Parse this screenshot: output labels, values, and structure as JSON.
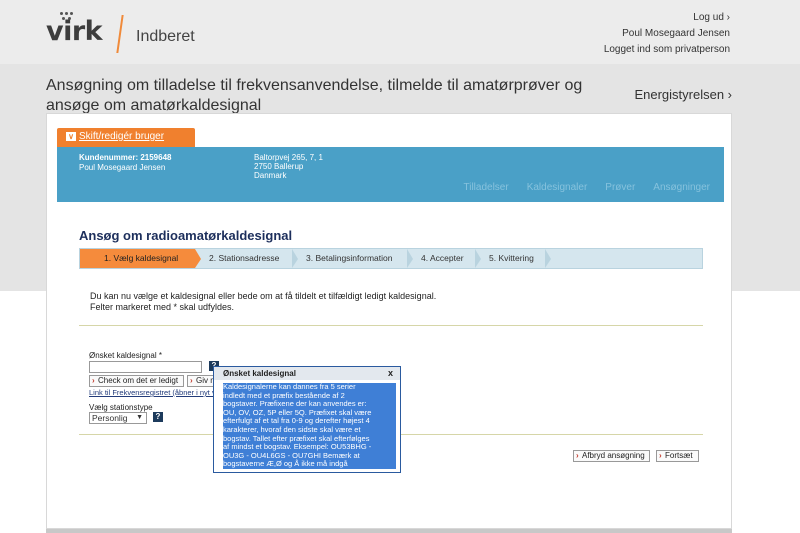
{
  "header": {
    "logo_text": "virk",
    "section": "Indberet",
    "logout": "Log ud ›",
    "user_name": "Poul Mosegaard Jensen",
    "login_status": "Logget ind som privatperson"
  },
  "page": {
    "title": "Ansøgning om tilladelse til frekvensanvendelse, tilmelde til amatørprøver og ansøge om amatørkaldesignal",
    "agency": "Energistyrelsen ›"
  },
  "user_panel": {
    "switch_user": "Skift/redigér bruger",
    "customer_number": "Kundenummer: 2159648",
    "customer_name": "Poul Mosegaard Jensen",
    "address_line1": "Baltorpvej 265, 7, 1",
    "address_line2": "2750 Ballerup",
    "address_line3": "Danmark",
    "nav": [
      "Tilladelser",
      "Kaldesignaler",
      "Prøver",
      "Ansøgninger"
    ]
  },
  "form": {
    "title": "Ansøg om radioamatørkaldesignal",
    "steps": [
      "1. Vælg kaldesignal",
      "2. Stationsadresse",
      "3. Betalingsinformation",
      "4. Accepter",
      "5. Kvittering"
    ],
    "intro_line1": "Du kan nu vælge et kaldesignal eller bede om at få tildelt et tilfældigt ledigt kaldesignal.",
    "intro_line2": "Felter markeret med * skal udfyldes.",
    "callsign_label": "Ønsket kaldesignal *",
    "callsign_value": "",
    "help": "?",
    "check_button": "Check om det er ledigt",
    "give_button": "Giv mig et ledigt",
    "register_link": "Link til Frekvensregistret (åbner i nyt vindue)",
    "station_type_label": "Vælg stationstype",
    "station_type_value": "Personlig",
    "cancel_button": "Afbryd ansøgning",
    "continue_button": "Fortsæt"
  },
  "tooltip": {
    "title": "Ønsket kaldesignal",
    "close": "x",
    "lines": [
      "Kaldesignalerne kan dannes fra 5 serier",
      "indledt med et præfix bestående af 2",
      "bogstaver. Præfixene der kan anvendes er:",
      "OU, OV, OZ, 5P eller 5Q. Præfixet skal være",
      "efterfulgt af et tal fra 0-9 og derefter højest 4",
      "karakterer, hvoraf den sidste skal være et",
      "bogstav. Tallet efter præfixet skal efterfølges",
      "af mindst et bogstav. Eksempel: OU53BHG -",
      "OU3G - OU4L6GS - OU7GHI Bemærk at",
      "bogstaverne Æ,Ø og Å ikke må indgå"
    ]
  }
}
